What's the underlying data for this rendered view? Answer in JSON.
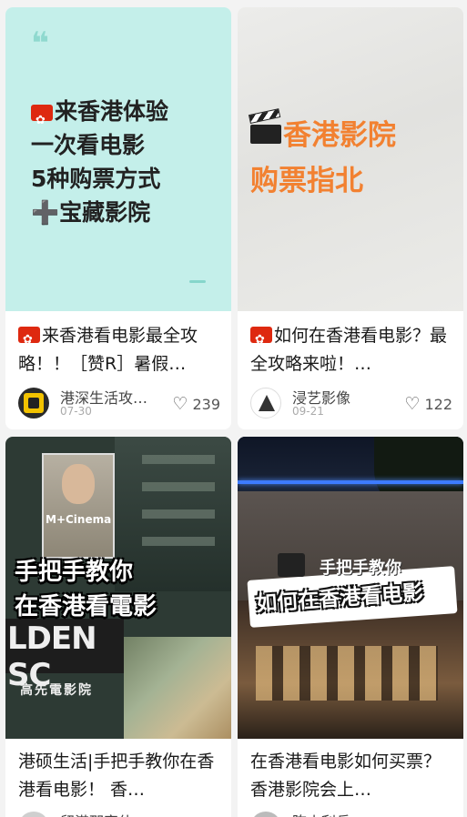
{
  "cards": [
    {
      "cover_lines": [
        "来香港体验",
        "一次看电影",
        "5种购票方式",
        "➕宝藏影院"
      ],
      "quote_mark": "❝",
      "title": "来香港看电影最全攻略！！［赞R］暑假…",
      "author": "港深生活攻…",
      "date": "07-30",
      "likes": "239"
    },
    {
      "cover_lines": [
        "香港影院",
        "购票指北"
      ],
      "title": "如何在香港看电影？最全攻略来啦！…",
      "author": "浸艺影像",
      "date": "09-21",
      "likes": "122"
    },
    {
      "poster_sign": "M+Cinema",
      "cover_lines": [
        "手把手教你",
        "在香港看電影"
      ],
      "sign_big": "LDEN SC",
      "sign_small": "高先電影院",
      "title": "港硕生活|手把手教你在香港看电影！ 香…",
      "author": "留港那家伙"
    },
    {
      "cover_small": "手把手教你",
      "cover_lines": [
        "如何在香港看电影"
      ],
      "title": "在香港看电影如何买票？ 香港影院会上…",
      "author": "陈小利兵"
    }
  ]
}
